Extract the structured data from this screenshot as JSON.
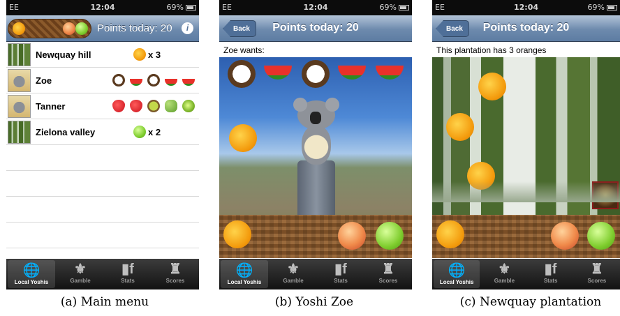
{
  "status_bar": {
    "carrier": "EE",
    "time": "12:04",
    "battery": "69%"
  },
  "panel_main": {
    "title": "Points today: 20",
    "rows": [
      {
        "name": "Newquay hill",
        "thumb": "trees",
        "fruits": [
          "orange"
        ],
        "count": "x 3"
      },
      {
        "name": "Zoe",
        "thumb": "koala",
        "fruits": [
          "coconut",
          "melon",
          "coconut",
          "melon",
          "melon"
        ],
        "count": ""
      },
      {
        "name": "Tanner",
        "thumb": "koala",
        "fruits": [
          "strawberry",
          "strawberry",
          "kiwi",
          "grapes",
          "lime"
        ],
        "count": ""
      },
      {
        "name": "Zielona valley",
        "thumb": "trees",
        "fruits": [
          "apple"
        ],
        "count": "x 2"
      }
    ],
    "caption": "(a) Main menu"
  },
  "panel_zoe": {
    "back_label": "Back",
    "title": "Points today: 20",
    "scene_text": "Zoe wants:",
    "wants": [
      "coconut",
      "melon",
      "coconut",
      "melon",
      "melon"
    ],
    "caption": "(b) Yoshi Zoe"
  },
  "panel_plantation": {
    "back_label": "Back",
    "title": "Points today: 20",
    "scene_text": "This plantation has 3 oranges",
    "caption": "(c) Newquay plantation"
  },
  "tab_bar": {
    "tabs": [
      "Local Yoshis",
      "Gamble",
      "Stats",
      "Scores"
    ],
    "active": 0
  },
  "icons": {
    "local": "globe-icon",
    "gamble": "fleur-de-lis-icon",
    "stats": "stats-f-icon",
    "scores": "trophy-icon",
    "info": "info-icon"
  },
  "colors": {
    "nav_blue": "#6d8aad",
    "tab_active": "#2f7fe0"
  }
}
